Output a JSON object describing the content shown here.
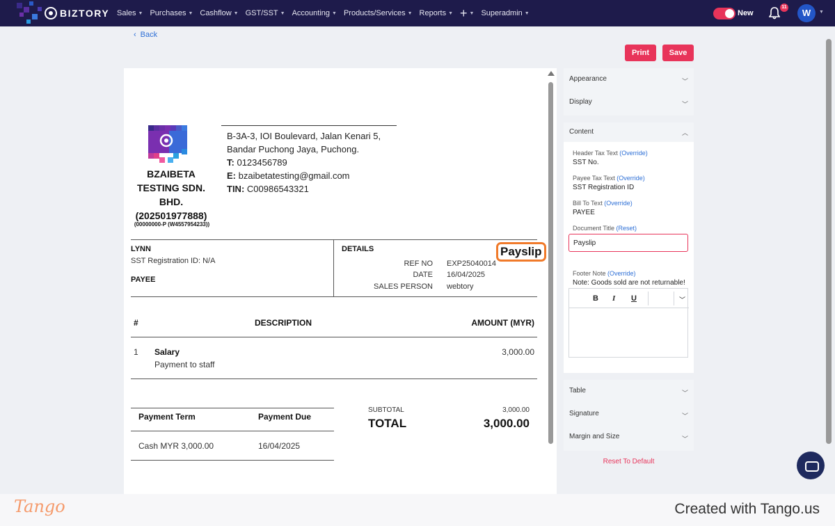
{
  "app": {
    "brand": "BIZTORY"
  },
  "nav": {
    "items": [
      "Sales",
      "Purchases",
      "Cashflow",
      "GST/SST",
      "Accounting",
      "Products/Services",
      "Reports"
    ],
    "extra": "Superadmin",
    "toggle_label": "New",
    "notifications": "11",
    "avatar": "W"
  },
  "toolbar": {
    "back": "Back",
    "print": "Print",
    "save": "Save"
  },
  "document": {
    "address_lines": [
      "B-3A-3, IOI Boulevard, Jalan Kenari 5,",
      "Bandar Puchong Jaya, Puchong."
    ],
    "phone_label": "T:",
    "phone": "0123456789",
    "email_label": "E:",
    "email": "bzaibetatesting@gmail.com",
    "tin_label": "TIN:",
    "tin": "C00986543321",
    "company_lines": [
      "BZAIBETA",
      "TESTING SDN.",
      "BHD.",
      "(202501977888)"
    ],
    "company_sub": "(00000000-P (W4557954233))",
    "payee_name": "LYNN",
    "payee_tax": "SST Registration ID: N/A",
    "payee_label": "PAYEE",
    "details_label": "DETAILS",
    "title": "Payslip",
    "details": [
      {
        "label": "REF NO",
        "value": "EXP25040014"
      },
      {
        "label": "DATE",
        "value": "16/04/2025"
      },
      {
        "label": "SALES PERSON",
        "value": "webtory"
      }
    ],
    "table": {
      "headers": [
        "#",
        "DESCRIPTION",
        "AMOUNT (MYR)"
      ],
      "rows": [
        {
          "no": "1",
          "item": "Salary",
          "desc": "Payment to staff",
          "amount": "3,000.00"
        }
      ]
    },
    "payment": {
      "headers": [
        "Payment Term",
        "Payment Due"
      ],
      "term": "Cash MYR 3,000.00",
      "due": "16/04/2025"
    },
    "subtotal_label": "SUBTOTAL",
    "subtotal": "3,000.00",
    "total_label": "TOTAL",
    "total": "3,000.00"
  },
  "panel": {
    "appearance": "Appearance",
    "display": "Display",
    "content": "Content",
    "fields": {
      "header_tax_label": "Header Tax Text",
      "header_tax": "SST No.",
      "payee_tax_label": "Payee Tax Text",
      "payee_tax": "SST Registration ID",
      "bill_to_label": "Bill To Text",
      "bill_to": "PAYEE",
      "doc_title_label": "Document Title",
      "doc_title": "Payslip",
      "footer_note_label": "Footer Note",
      "footer_note": "Note: Goods sold are not returnable!",
      "override": "(Override)",
      "reset": "(Reset)"
    },
    "table": "Table",
    "signature": "Signature",
    "margin": "Margin and Size",
    "reset_default": "Reset To Default"
  },
  "footer": {
    "logo": "Tango",
    "created": "Created with Tango.us"
  },
  "colors": {
    "nav": "#1e1b4b",
    "accent": "#e8345a",
    "highlight": "#f07a2a",
    "link": "#2d6fd6"
  }
}
